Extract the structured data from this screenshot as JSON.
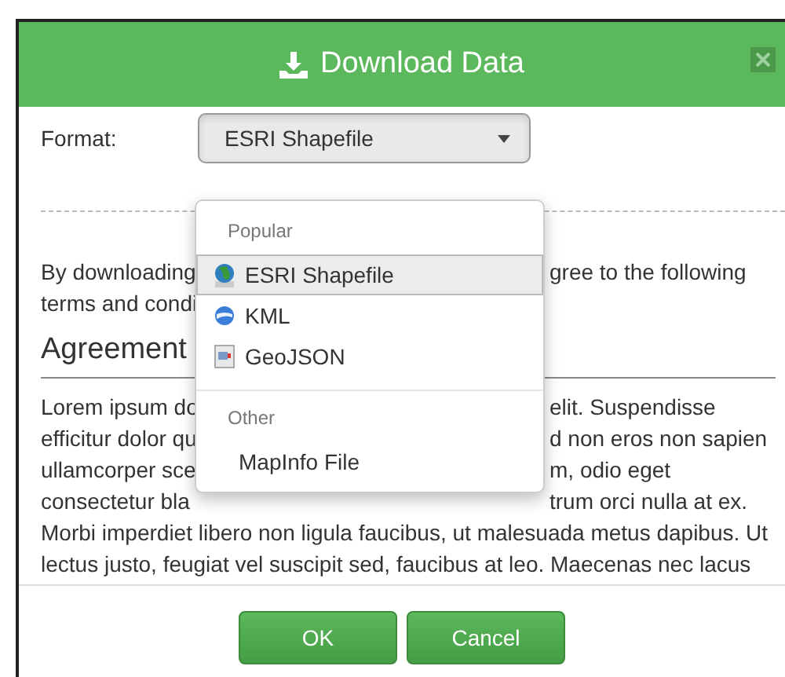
{
  "dialog": {
    "title": "Download Data",
    "format": {
      "label": "Format:",
      "value": "ESRI Shapefile",
      "expanded": true,
      "menu": [
        {
          "heading": "Popular",
          "items": [
            {
              "label": "ESRI Shapefile",
              "kind": "globe",
              "selected": true
            },
            {
              "label": "KML",
              "kind": "earth",
              "selected": false
            },
            {
              "label": "GeoJSON",
              "kind": "document",
              "selected": false
            }
          ]
        },
        {
          "heading": "Other",
          "items": [
            {
              "label": "MapInfo File",
              "kind": "plain",
              "selected": false
            }
          ]
        }
      ]
    },
    "intro": [
      {
        "fragments": [
          "By downloading",
          "gree to the following"
        ]
      },
      {
        "fragments": [
          "terms and condi"
        ]
      }
    ],
    "heading": "Agreement",
    "agreement": [
      {
        "fragments": [
          "Lorem ipsum do",
          "elit. Suspendisse"
        ]
      },
      {
        "fragments": [
          "efficitur dolor qu",
          "d non eros non sapien"
        ]
      },
      {
        "fragments": [
          "ullamcorper sce",
          "m, odio eget"
        ]
      },
      {
        "fragments": [
          "consectetur bla",
          "trum orci nulla at ex."
        ]
      },
      {
        "fragments": [
          "Morbi imperdiet libero non ligula faucibus, ut malesuada metus dapibus. Ut"
        ]
      },
      {
        "fragments": [
          "lectus justo, feugiat vel suscipit sed, faucibus at leo. Maecenas nec lacus"
        ]
      }
    ],
    "buttons": [
      {
        "label": "OK"
      },
      {
        "label": "Cancel"
      }
    ]
  }
}
